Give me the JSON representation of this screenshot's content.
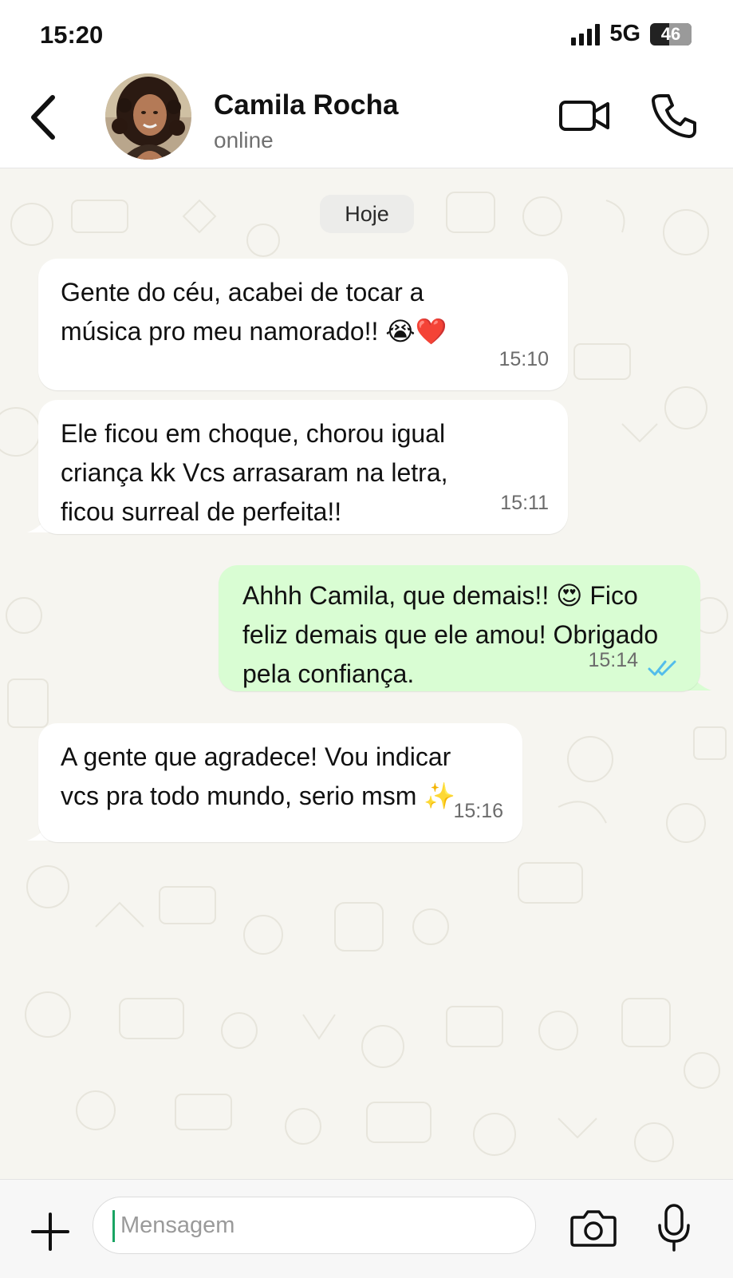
{
  "status_bar": {
    "time": "15:20",
    "network": "5G",
    "battery_level": "46",
    "battery_fraction": 0.46
  },
  "header": {
    "contact_name": "Camila Rocha",
    "contact_status": "online"
  },
  "chat": {
    "date_label": "Hoje",
    "messages": [
      {
        "direction": "incoming",
        "text": "Gente do céu, acabei de tocar a\nmúsica pro meu namorado!! 😭❤️",
        "time": "15:10"
      },
      {
        "direction": "incoming",
        "text": "Ele ficou em choque, chorou igual\ncriança kk Vcs arrasaram na letra,\nficou surreal de perfeita!!",
        "time": "15:11"
      },
      {
        "direction": "outgoing",
        "text": "Ahhh Camila, que demais!! 😍 Fico\nfeliz demais que ele amou! Obrigado\npela confiança.",
        "time": "15:14",
        "read": true
      },
      {
        "direction": "incoming",
        "text": "A gente que agradece! Vou indicar\nvcs pra todo mundo, serio msm ✨",
        "time": "15:16"
      }
    ]
  },
  "input_bar": {
    "placeholder": "Mensagem"
  },
  "icons": [
    "back-arrow-icon",
    "video-camera-icon",
    "phone-icon",
    "plus-icon",
    "camera-icon",
    "microphone-icon",
    "double-check-icon"
  ],
  "colors": {
    "outgoing_bubble": "#d9fdd3",
    "incoming_bubble": "#ffffff",
    "read_ticks": "#53bdeb",
    "chat_background": "#f6f5f0",
    "cursor": "#19a463"
  }
}
